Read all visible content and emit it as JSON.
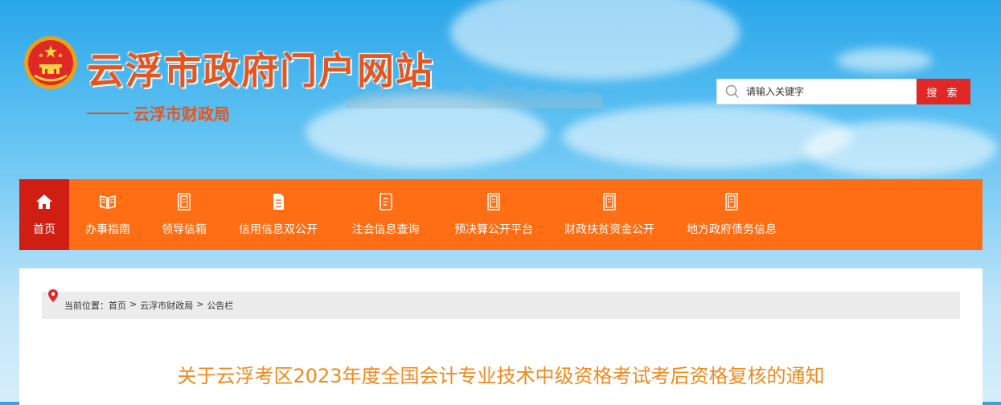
{
  "header": {
    "site_title": "云浮市政府门户网站",
    "department": "云浮市财政局"
  },
  "search": {
    "placeholder": "请输入关键字",
    "button_label": "搜 索"
  },
  "nav": {
    "items": [
      {
        "label": "首页",
        "icon": "home-icon"
      },
      {
        "label": "办事指南",
        "icon": "open-book-icon"
      },
      {
        "label": "领导信箱",
        "icon": "document-icon"
      },
      {
        "label": "信用信息双公开",
        "icon": "file-icon"
      },
      {
        "label": "注会信息查询",
        "icon": "notepad-icon"
      },
      {
        "label": "预决算公开平台",
        "icon": "document-icon"
      },
      {
        "label": "财政扶贫资金公开",
        "icon": "document-icon"
      },
      {
        "label": "地方政府债务信息",
        "icon": "document-icon"
      }
    ]
  },
  "breadcrumb": {
    "prefix": "当前位置：",
    "items": [
      "首页",
      "云浮市财政局",
      "公告栏"
    ],
    "separator": ">"
  },
  "article": {
    "title": "关于云浮考区2023年度全国会计专业技术中级资格考试考后资格复核的通知"
  },
  "colors": {
    "title_orange": "#e8541e",
    "nav_orange": "#ff6d14",
    "home_red": "#d11e12",
    "search_red": "#e02826",
    "article_title": "#f08a1c"
  }
}
